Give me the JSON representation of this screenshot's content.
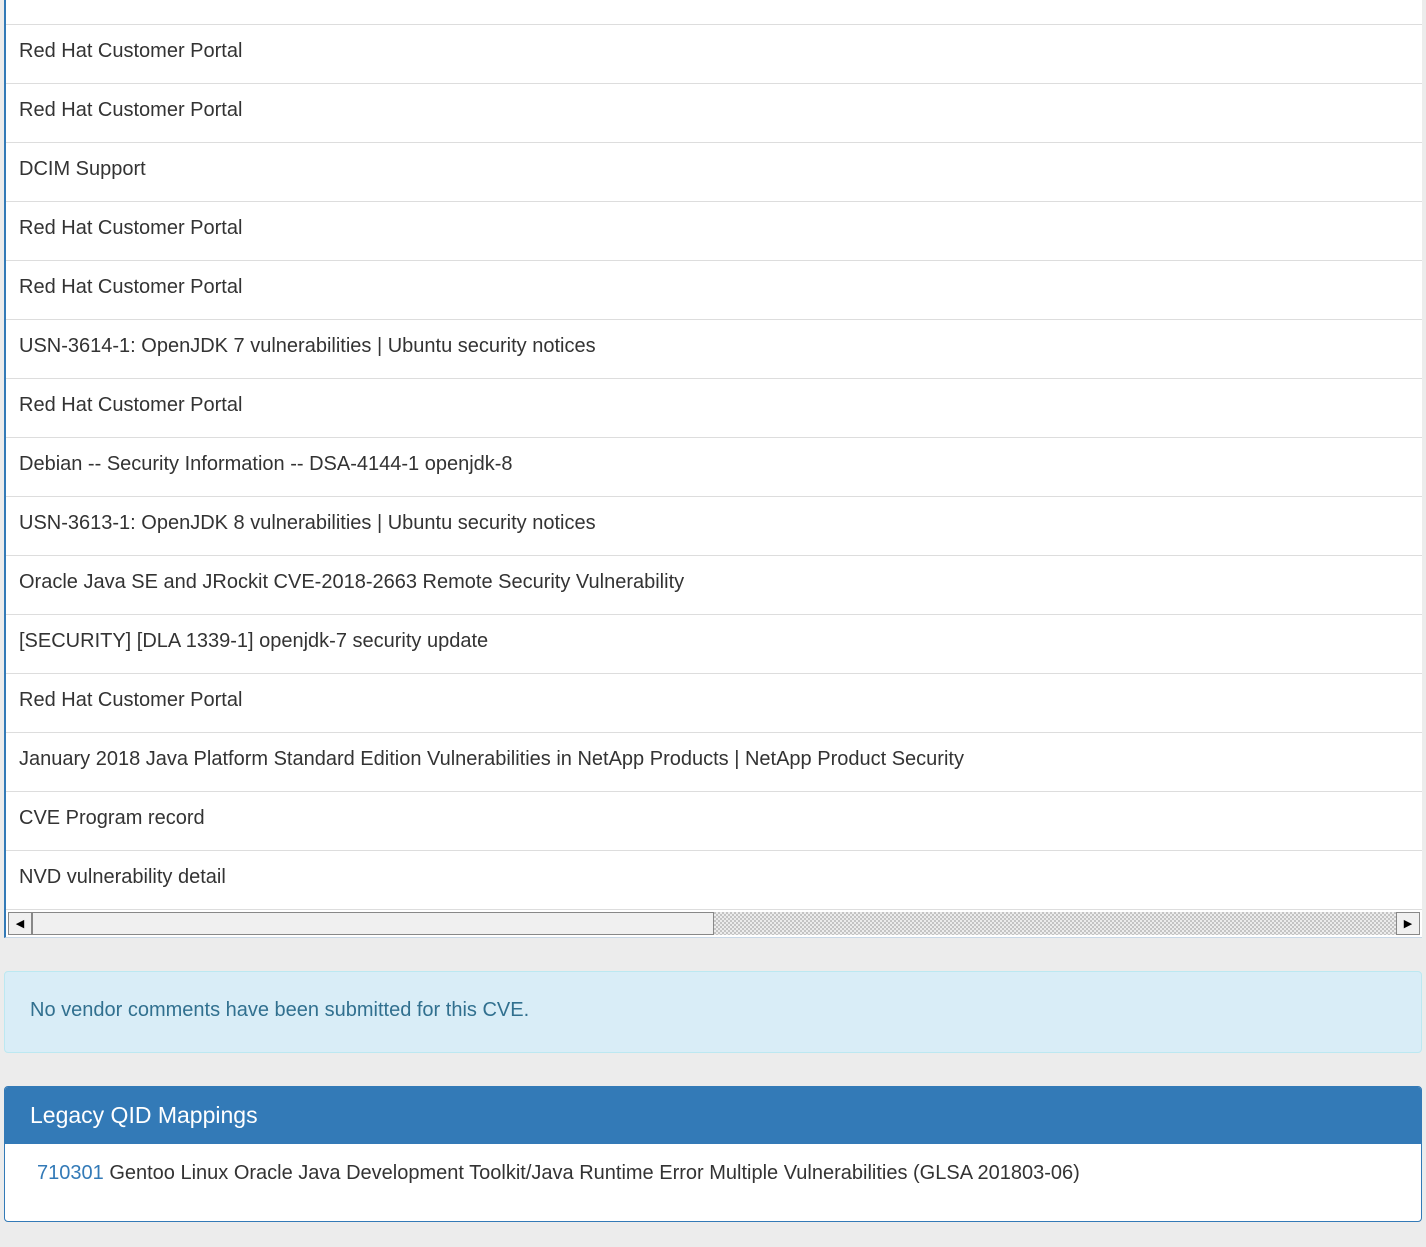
{
  "references": {
    "rows": [
      "Red Hat Customer Portal",
      "Red Hat Customer Portal",
      "DCIM Support",
      "Red Hat Customer Portal",
      "Red Hat Customer Portal",
      "USN-3614-1: OpenJDK 7 vulnerabilities | Ubuntu security notices",
      "Red Hat Customer Portal",
      "Debian -- Security Information -- DSA-4144-1 openjdk-8",
      "USN-3613-1: OpenJDK 8 vulnerabilities | Ubuntu security notices",
      "Oracle Java SE and JRockit CVE-2018-2663 Remote Security Vulnerability",
      "[SECURITY] [DLA 1339-1] openjdk-7 security update",
      "Red Hat Customer Portal",
      "January 2018 Java Platform Standard Edition Vulnerabilities in NetApp Products | NetApp Product Security",
      "CVE Program record",
      "NVD vulnerability detail"
    ],
    "scrollbar": {
      "left_icon": "left-arrow-icon",
      "right_icon": "right-arrow-icon",
      "thumb_fraction": 0.5
    }
  },
  "vendor_comments": {
    "text": "No vendor comments have been submitted for this CVE."
  },
  "legacy_qid": {
    "heading": "Legacy QID Mappings",
    "items": [
      {
        "qid": "710301",
        "description": "Gentoo Linux Oracle Java Development Toolkit/Java Runtime Error Multiple Vulnerabilities (GLSA 201803-06)"
      }
    ]
  },
  "colors": {
    "primary": "#337ab7",
    "info_bg": "#d9edf7",
    "info_text": "#31708f",
    "page_bg": "#ececec"
  }
}
